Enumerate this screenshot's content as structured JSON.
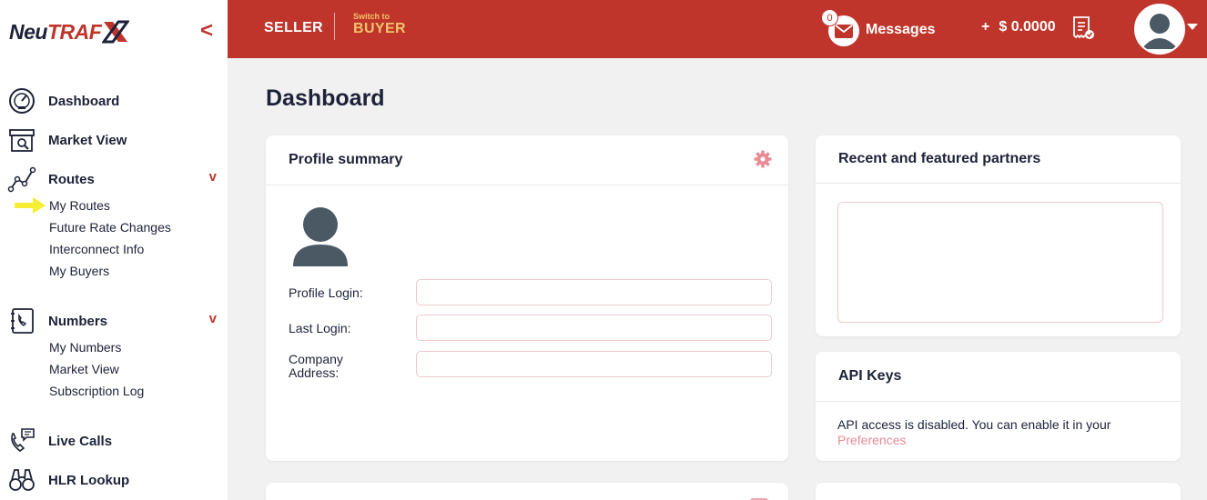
{
  "brand": {
    "logo_neu": "Neu",
    "logo_traf": "TRAF",
    "logo_x": "X",
    "collapse_glyph": "<"
  },
  "header": {
    "role_label": "SELLER",
    "switch_small": "Switch to",
    "switch_big": "BUYER",
    "messages_count": "0",
    "messages_label": "Messages",
    "balance_plus": "+",
    "balance": "$ 0.0000"
  },
  "sidebar": {
    "items": [
      {
        "label": "Dashboard",
        "icon": "speedometer-icon"
      },
      {
        "label": "Market View",
        "icon": "storefront-icon"
      },
      {
        "label": "Routes",
        "icon": "route-graph-icon",
        "chevron": "v",
        "children": [
          "My Routes",
          "Future Rate Changes",
          "Interconnect Info",
          "My Buyers"
        ]
      },
      {
        "label": "Numbers",
        "icon": "phonebook-icon",
        "chevron": "v",
        "children": [
          "My Numbers",
          "Market View",
          "Subscription Log"
        ]
      },
      {
        "label": "Live Calls",
        "icon": "phone-chat-icon"
      },
      {
        "label": "HLR Lookup",
        "icon": "binoculars-icon"
      }
    ],
    "highlight_color": "#f5ee32"
  },
  "main": {
    "title": "Dashboard",
    "profile_summary": {
      "title": "Profile summary",
      "fields": [
        {
          "label": "Profile Login:",
          "value": ""
        },
        {
          "label": "Last Login:",
          "value": ""
        },
        {
          "label": "Company Address:",
          "value": ""
        }
      ]
    },
    "partners": {
      "title": "Recent and featured partners"
    },
    "api_keys": {
      "title": "API Keys",
      "text": "API access is disabled. You can enable it in your",
      "link": "Preferences"
    }
  },
  "colors": {
    "accent": "#c0352b",
    "gold": "#f2c26b",
    "navy": "#1d2238",
    "link": "#e98a95"
  }
}
